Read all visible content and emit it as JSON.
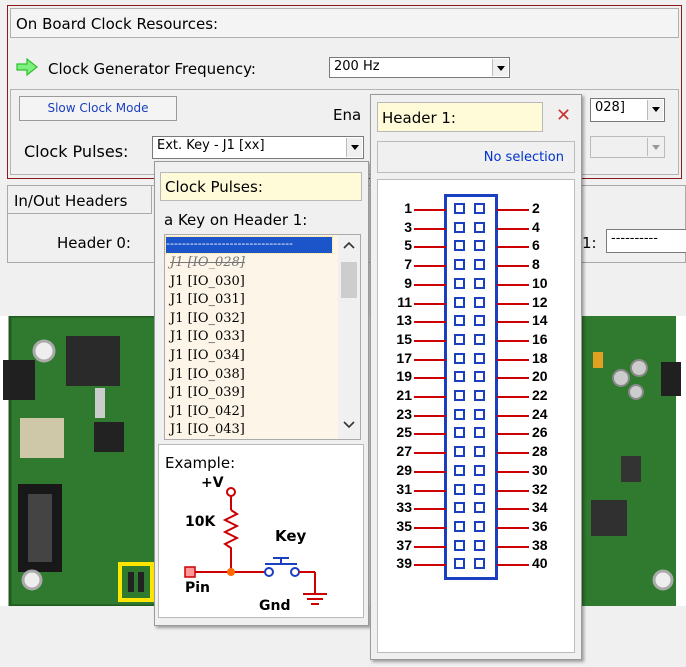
{
  "onboard": {
    "section_title": "On Board Clock Resources:",
    "clock_gen_label": "Clock Generator Frequency:",
    "clock_gen_value": "200 Hz",
    "slow_clock_button": "Slow Clock Mode",
    "enable_label": "Ena",
    "enable_value": "028]",
    "clock_pulses_label": "Clock Pulses:",
    "clock_pulses_value": "Ext. Key - J1 [xx]"
  },
  "inout": {
    "section_title": "In/Out Headers",
    "header0_label": "Header 0:",
    "header1_partial_label": "1:",
    "header1_value": "----------"
  },
  "clock_pulses_popup": {
    "title": "Clock Pulses:",
    "subtitle": "a Key on Header 1:",
    "selected": "--------------------------------",
    "items": [
      "J1 [IO_028]",
      "J1 [IO_030]",
      "J1 [IO_031]",
      "J1 [IO_032]",
      "J1 [IO_033]",
      "J1 [IO_034]",
      "J1 [IO_038]",
      "J1 [IO_039]",
      "J1 [IO_042]",
      "J1 [IO_043]"
    ],
    "example_label": "Example:",
    "schematic": {
      "vplus": "+V",
      "resistor": "10K",
      "key": "Key",
      "pin": "Pin",
      "gnd": "Gnd"
    }
  },
  "header_popup": {
    "title": "Header 1:",
    "close_symbol": "✕",
    "no_selection": "No selection",
    "left_pins": [
      "1",
      "3",
      "5",
      "7",
      "9",
      "11",
      "13",
      "15",
      "17",
      "19",
      "21",
      "23",
      "25",
      "27",
      "29",
      "31",
      "33",
      "35",
      "37",
      "39"
    ],
    "right_pins": [
      "2",
      "4",
      "6",
      "8",
      "10",
      "12",
      "14",
      "16",
      "18",
      "20",
      "22",
      "24",
      "26",
      "28",
      "30",
      "32",
      "34",
      "36",
      "38",
      "40"
    ]
  },
  "colors": {
    "accent_red": "#8b1a1a",
    "link_blue": "#0033cc",
    "arrow_green": "#2fbf2f",
    "pin_red": "#cc0000",
    "pad_blue": "#1a3fc1",
    "list_bg": "#fdf6e8",
    "popup_yellow": "#fffbd9"
  },
  "icons": {
    "arrow": "green-right-arrow-icon",
    "close": "close-x-icon",
    "scroll_up": "chevron-up-icon",
    "scroll_down": "chevron-down-icon"
  }
}
